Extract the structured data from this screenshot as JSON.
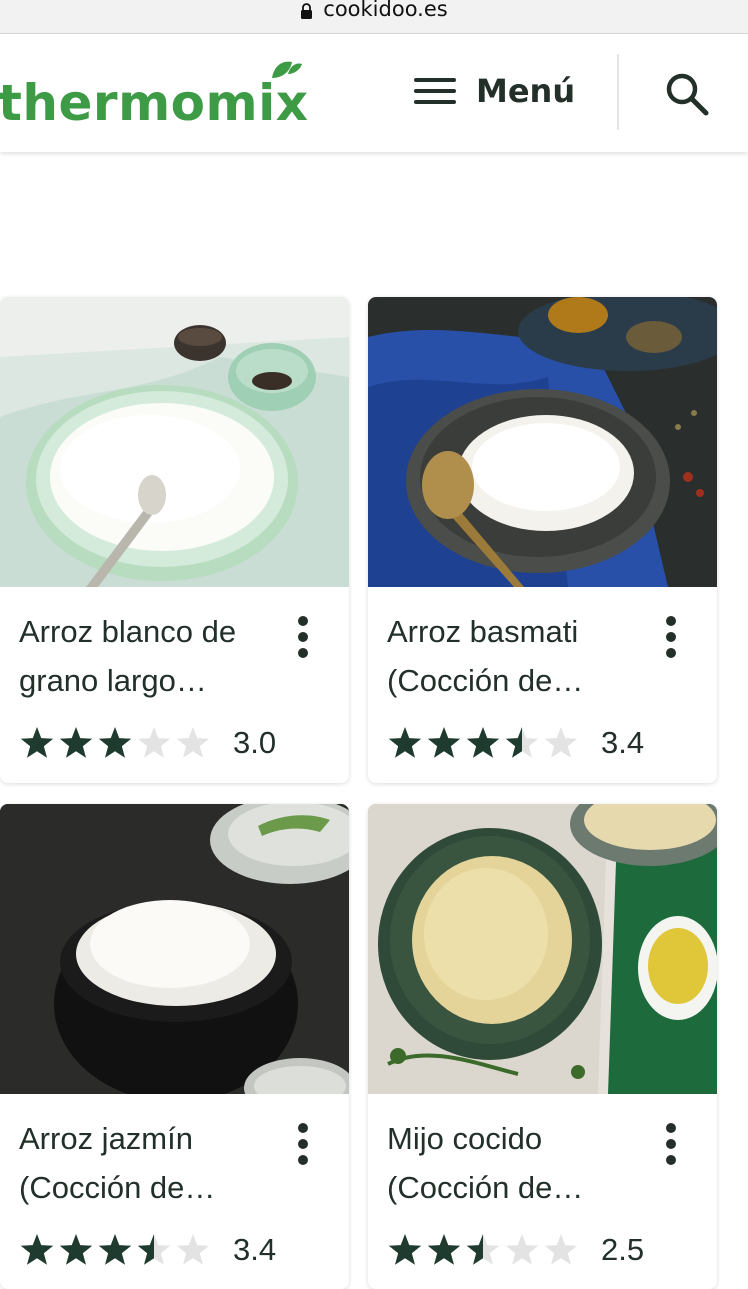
{
  "browser": {
    "url": "cookidoo.es"
  },
  "header": {
    "logo_text": "thermomix",
    "menu_label": "Menú",
    "icons": [
      "menu-icon",
      "search-icon"
    ],
    "brand_color": "#3d9b45"
  },
  "recipes": [
    {
      "title": "Arroz blanco de grano largo…",
      "rating": 3.0,
      "rating_text": "3.0"
    },
    {
      "title": "Arroz basmati (Cocción de…",
      "rating": 3.4,
      "rating_text": "3.4"
    },
    {
      "title": "Arroz jazmín (Cocción de…",
      "rating": 3.4,
      "rating_text": "3.4"
    },
    {
      "title": "Mijo cocido (Cocción de…",
      "rating": 2.5,
      "rating_text": "2.5"
    }
  ],
  "colors": {
    "star_filled": "#1f3a2e",
    "star_empty": "#e3e3e3",
    "text": "#23302a"
  }
}
